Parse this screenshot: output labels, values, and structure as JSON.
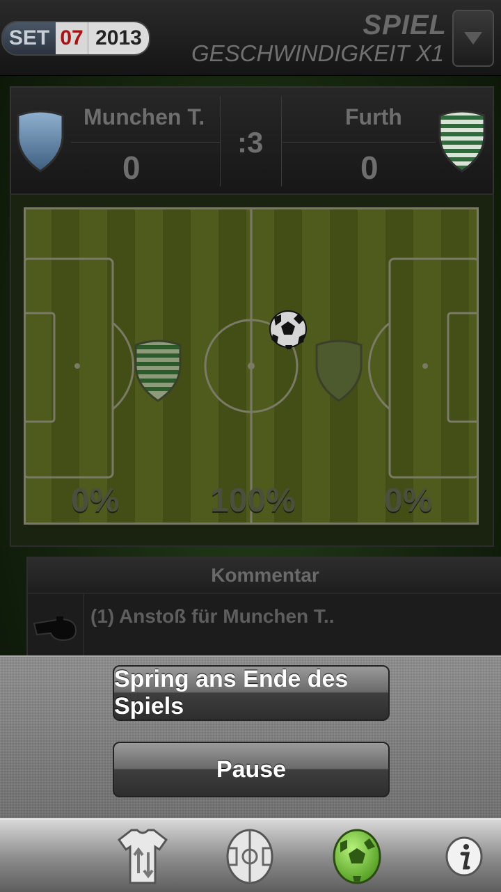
{
  "header": {
    "date": {
      "month": "SET",
      "day": "07",
      "year": "2013"
    },
    "title_line1": "SPIEL",
    "title_line2": "GESCHWINDIGKEIT X1"
  },
  "match": {
    "home_team": "Munchen T.",
    "home_score": "0",
    "away_team": "Furth",
    "away_score": "0",
    "minute": ":3"
  },
  "pitch": {
    "left_percent": "0%",
    "center_percent": "100%",
    "right_percent": "0%"
  },
  "commentary": {
    "header": "Kommentar",
    "entries": [
      {
        "text": "(1) Anstoß für Munchen T.."
      }
    ]
  },
  "action_sheet": {
    "skip_label": "Spring ans Ende des Spiels",
    "pause_label": "Pause"
  },
  "colors": {
    "home_crest": "#5f7f9f",
    "away_crest": "#2f6a3c",
    "accent_green": "#74c236"
  },
  "tabbar": {
    "items": [
      {
        "icon": "jersey-substitution-icon"
      },
      {
        "icon": "tactics-pitch-icon"
      },
      {
        "icon": "match-ball-icon",
        "active": true
      },
      {
        "icon": "info-icon"
      }
    ]
  }
}
